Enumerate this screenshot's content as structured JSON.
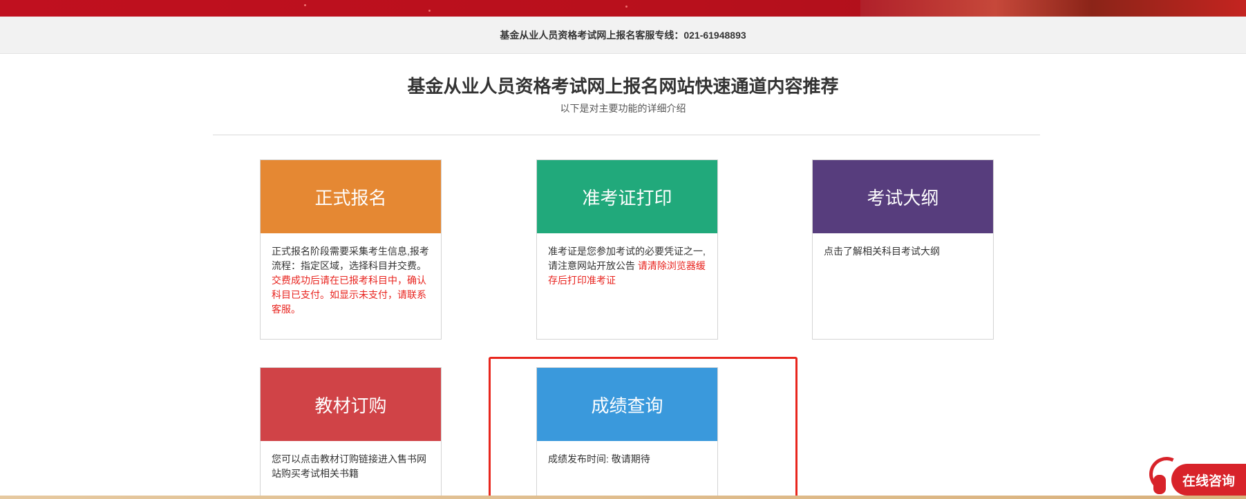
{
  "hotline": "基金从业人员资格考试网上报名客服专线：021-61948893",
  "section": {
    "title": "基金从业人员资格考试网上报名网站快速通道内容推荐",
    "subtitle": "以下是对主要功能的详细介绍"
  },
  "cards": [
    {
      "title": "正式报名",
      "color": "#e58833",
      "text": "正式报名阶段需要采集考生信息,报考流程：指定区域，选择科目并交费。",
      "red_text": "交费成功后请在已报考科目中，确认科目已支付。如显示未支付，请联系客服。"
    },
    {
      "title": "准考证打印",
      "color": "#21a97b",
      "text": "准考证是您参加考试的必要凭证之一,请注意网站开放公告",
      "red_text": "请清除浏览器缓存后打印准考证"
    },
    {
      "title": "考试大纲",
      "color": "#573d7d",
      "text": "点击了解相关科目考试大纲",
      "red_text": ""
    },
    {
      "title": "教材订购",
      "color": "#d04347",
      "text": "您可以点击教材订购链接进入售书网站购买考试相关书籍",
      "red_text": ""
    },
    {
      "title": "成绩查询",
      "color": "#3a99dc",
      "text": "成绩发布时间: 敬请期待",
      "red_text": ""
    }
  ],
  "consult": {
    "label": "在线咨询",
    "icon": "headset-icon",
    "color": "#d8232a"
  },
  "highlight_color": "#e8261d"
}
